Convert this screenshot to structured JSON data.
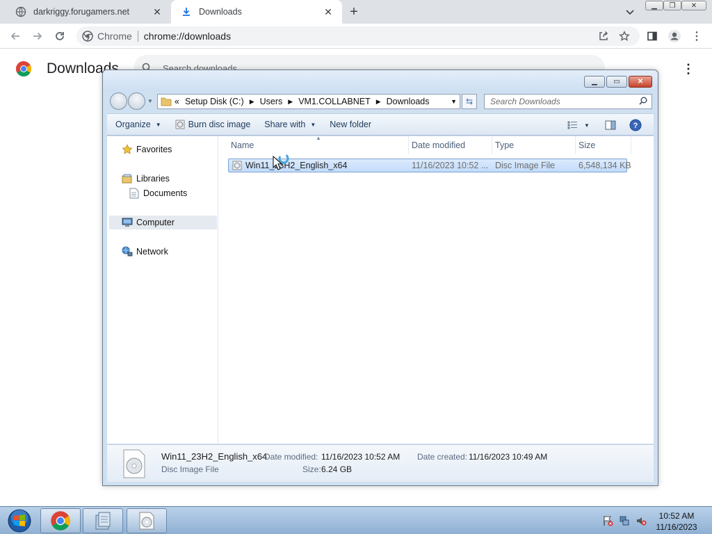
{
  "browser": {
    "tabs": [
      {
        "title": "darkriggy.forugamers.net",
        "icon": "globe-icon"
      },
      {
        "title": "Downloads",
        "icon": "download-icon"
      }
    ],
    "new_tab_symbol": "+",
    "omnibox": {
      "chip_label": "Chrome",
      "url": "chrome://downloads"
    }
  },
  "downloads_page": {
    "title": "Downloads",
    "search_placeholder": "Search downloads"
  },
  "explorer": {
    "breadcrumb": [
      "Setup Disk (C:)",
      "Users",
      "VM1.COLLABNET",
      "Downloads"
    ],
    "breadcrumb_prefix": "«",
    "search_placeholder": "Search Downloads",
    "commands": [
      {
        "label": "Organize",
        "has_dropdown": true
      },
      {
        "label": "Burn disc image",
        "has_dropdown": false,
        "icon": "disc-burn-icon"
      },
      {
        "label": "Share with",
        "has_dropdown": true
      },
      {
        "label": "New folder",
        "has_dropdown": false
      }
    ],
    "nav_pane": {
      "favorites": "Favorites",
      "libraries": "Libraries",
      "documents": "Documents",
      "computer": "Computer",
      "network": "Network",
      "selected": "Computer"
    },
    "columns": {
      "name": "Name",
      "date_modified": "Date modified",
      "type": "Type",
      "size": "Size"
    },
    "files": [
      {
        "name": "Win11_23H2_English_x64",
        "date_modified": "11/16/2023 10:52 ...",
        "type": "Disc Image File",
        "size": "6,548,134 KB",
        "selected": true
      }
    ],
    "details": {
      "name": "Win11_23H2_English_x64",
      "type": "Disc Image File",
      "date_modified_label": "Date modified:",
      "date_modified_value": "11/16/2023 10:52 AM",
      "date_created_label": "Date created:",
      "date_created_value": "11/16/2023 10:49 AM",
      "size_label": "Size:",
      "size_value": "6.24 GB"
    }
  },
  "taskbar": {
    "time": "10:52 AM",
    "date": "11/16/2023",
    "pinned": [
      "chrome-icon",
      "explorer-icon",
      "disc-image-icon"
    ]
  },
  "colors": {
    "chrome_tabstrip": "#dee1e6",
    "explorer_frame": "#cfe0f1",
    "selection": "#c2dcfd",
    "taskbar": "#8fb0d3"
  }
}
